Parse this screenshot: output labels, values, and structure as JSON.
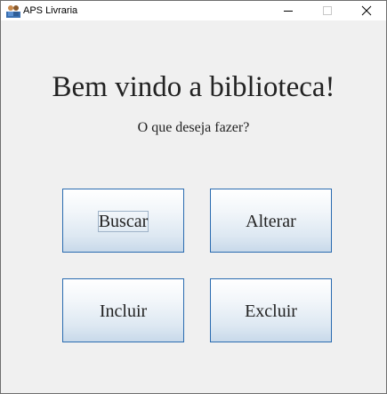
{
  "window": {
    "title": "APS Livraria",
    "icon": "app-people-icon"
  },
  "main": {
    "heading": "Bem vindo a biblioteca!",
    "subheading": "O que deseja fazer?",
    "buttons": {
      "search_label": "Buscar",
      "edit_label": "Alterar",
      "add_label": "Incluir",
      "delete_label": "Excluir"
    },
    "focused_button": "Buscar"
  },
  "colors": {
    "button_border": "#2a6bb0",
    "text": "#222222",
    "window_background": "#f0f0f0"
  }
}
